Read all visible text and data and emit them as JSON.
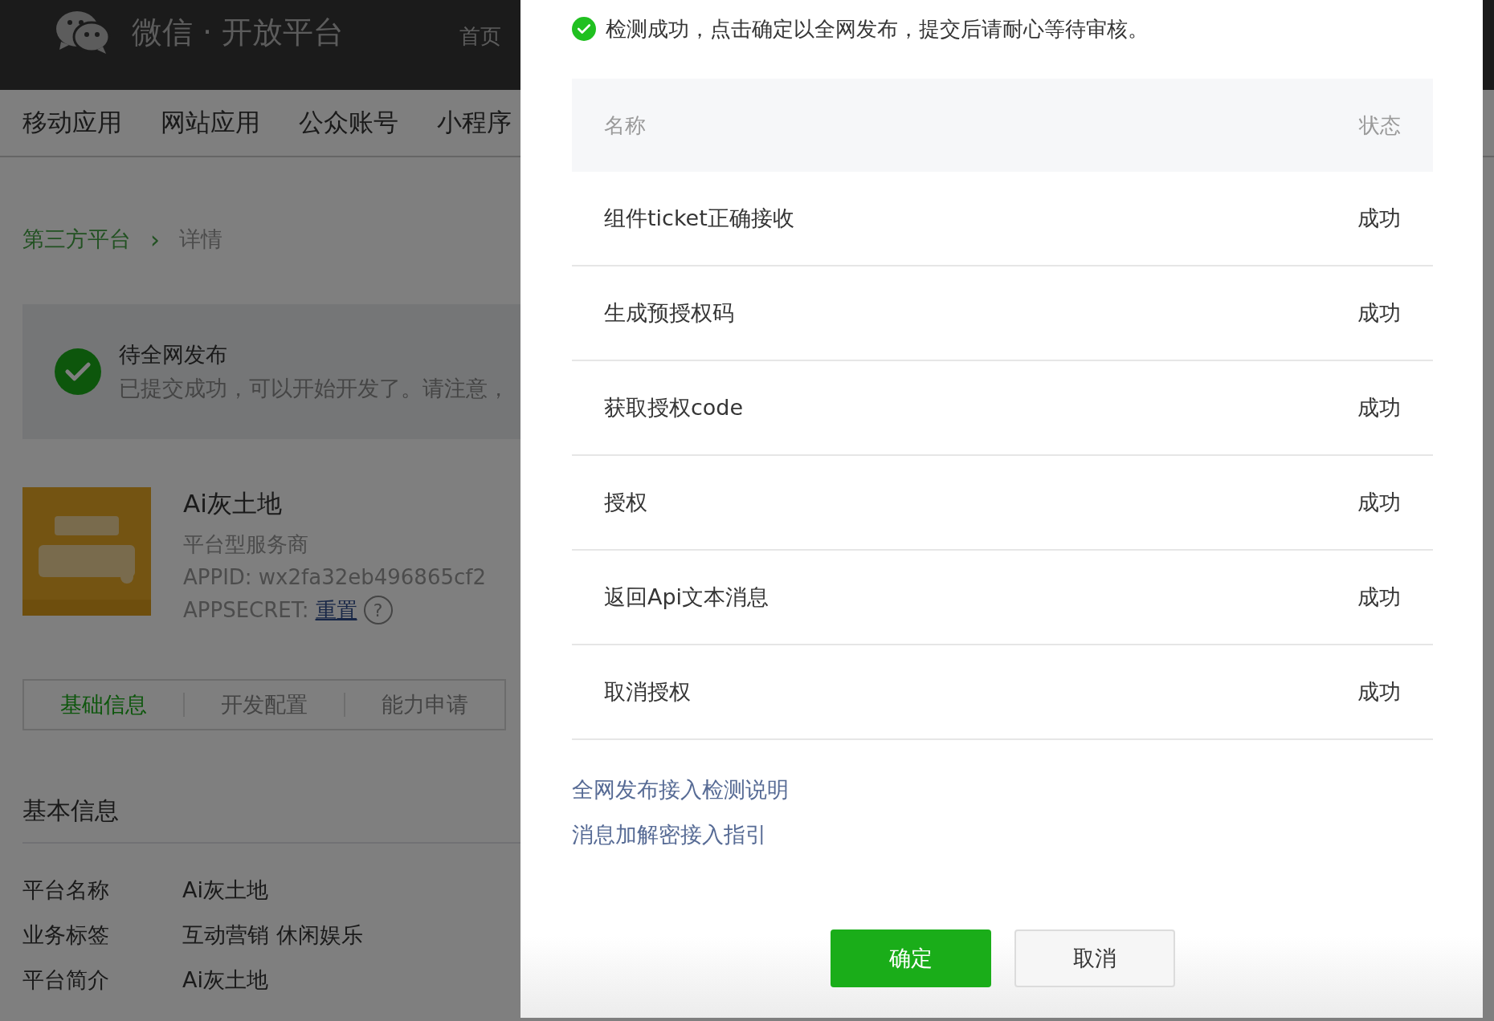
{
  "header": {
    "brand": "微信 · 开放平台",
    "links": [
      "首页"
    ]
  },
  "nav": [
    {
      "label": "移动应用",
      "selected": false
    },
    {
      "label": "网站应用",
      "selected": false
    },
    {
      "label": "公众账号",
      "selected": false
    },
    {
      "label": "小程序",
      "selected": false
    }
  ],
  "breadcrumb": {
    "parent": "第三方平台",
    "separator": "›",
    "current": "详情"
  },
  "notice": {
    "title": "待全网发布",
    "text": "已提交成功，可以开始开发了。请注意，"
  },
  "app": {
    "kind": "picture",
    "name": "Ai灰土地",
    "type": "平台型服务商",
    "appid": "APPID: wx2fa32eb496865cf2",
    "secret_label": "APPSECRET:",
    "secret_link": "重置",
    "help": "?"
  },
  "tabs": [
    {
      "label": "基础信息",
      "selected": true
    },
    {
      "label": "开发配置",
      "selected": false
    },
    {
      "label": "能力申请",
      "selected": false
    }
  ],
  "basic": {
    "title": "基本信息",
    "rows": [
      {
        "label": "平台名称",
        "value": "Ai灰土地"
      },
      {
        "label": "业务标签",
        "value": "互动营销 休闲娱乐"
      },
      {
        "label": "平台简介",
        "value": "Ai灰土地"
      }
    ]
  },
  "dialog": {
    "message": "检测成功，点击确定以全网发布，提交后请耐心等待审核。",
    "columns": [
      "名称",
      "状态"
    ],
    "rows": [
      {
        "name": "组件ticket正确接收",
        "status": "成功"
      },
      {
        "name": "生成预授权码",
        "status": "成功"
      },
      {
        "name": "获取授权code",
        "status": "成功"
      },
      {
        "name": "授权",
        "status": "成功"
      },
      {
        "name": "返回Api文本消息",
        "status": "成功"
      },
      {
        "name": "取消授权",
        "status": "成功"
      }
    ],
    "links": [
      "全网发布接入检测说明",
      "消息加解密接入指引"
    ],
    "buttons": [
      {
        "label": "确定",
        "kind": "primary"
      },
      {
        "label": "取消",
        "kind": "default"
      }
    ]
  }
}
